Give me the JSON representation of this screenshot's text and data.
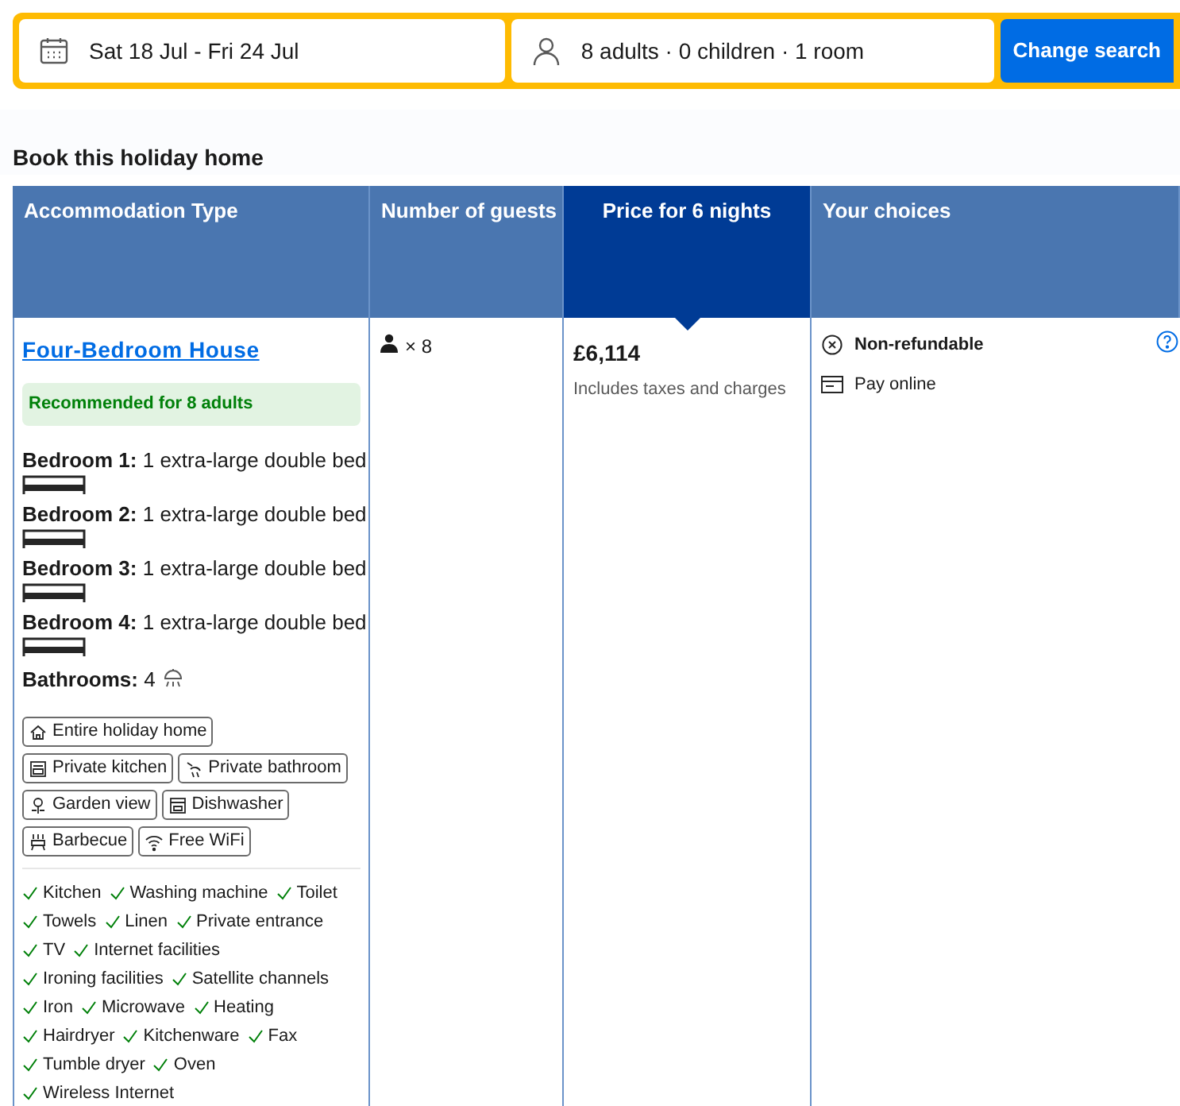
{
  "search_bar": {
    "dates": "Sat 18 Jul - Fri 24 Jul",
    "guests": "8 adults · 0 children · 1 room",
    "button": "Change search"
  },
  "section_title": "Book this holiday home",
  "table": {
    "columns": [
      {
        "label": "Accommodation Type",
        "selected": false
      },
      {
        "label": "Number of guests",
        "selected": false
      },
      {
        "label": "Price for 6 nights",
        "selected": true
      },
      {
        "label": "Your choices",
        "selected": false
      }
    ],
    "rows": [
      {
        "name": "Four-Bedroom House",
        "recommendation": "Recommended for 8 adults",
        "bedrooms": [
          {
            "label": "Bedroom 1:",
            "value": "1 extra-large double bed"
          },
          {
            "label": "Bedroom 2:",
            "value": "1 extra-large double bed"
          },
          {
            "label": "Bedroom 3:",
            "value": "1 extra-large double bed"
          },
          {
            "label": "Bedroom 4:",
            "value": "1 extra-large double bed"
          }
        ],
        "bathrooms_label": "Bathrooms:",
        "bathrooms_value": "4",
        "feature_rows": [
          [
            "Entire holiday home"
          ],
          [
            "Private kitchen",
            "Private bathroom"
          ],
          [
            "Garden view",
            "Dishwasher"
          ],
          [
            "Barbecue",
            "Free WiFi"
          ]
        ],
        "amenity_rows": [
          [
            "Kitchen",
            "Washing machine",
            "Toilet"
          ],
          [
            "Towels",
            "Linen",
            "Private entrance"
          ],
          [
            "TV",
            "Internet facilities"
          ],
          [
            "Ironing facilities",
            "Satellite channels"
          ],
          [
            "Iron",
            "Microwave",
            "Heating"
          ],
          [
            "Hairdryer",
            "Kitchenware",
            "Fax"
          ],
          [
            "Tumble dryer",
            "Oven"
          ],
          [
            "Wireless Internet"
          ]
        ],
        "guests": "× 8",
        "price": "£6,114",
        "price_note": "Includes taxes and charges",
        "choices": [
          {
            "kind": "policy",
            "text": "Non-refundable"
          },
          {
            "kind": "payment",
            "text": "Pay online"
          }
        ]
      }
    ]
  }
}
